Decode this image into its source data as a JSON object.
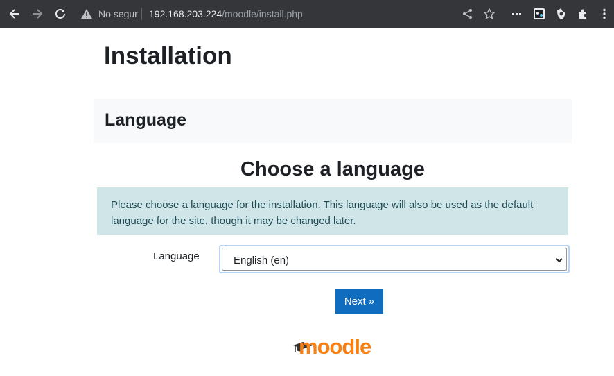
{
  "browser": {
    "security_label": "No segur",
    "url_host": "192.168.203.224",
    "url_path": "/moodle/install.php",
    "icons": [
      "back-arrow-icon",
      "forward-arrow-icon",
      "reload-icon",
      "warning-icon",
      "share-icon",
      "star-icon",
      "extension-dots-icon",
      "extension-badge-icon",
      "extension-shield-icon",
      "puzzle-icon",
      "kebab-menu-icon"
    ]
  },
  "page": {
    "title": "Installation",
    "section_title": "Language",
    "heading": "Choose a language",
    "alert": "Please choose a language for the installation. This language will also be used as the default language for the site, though it may be changed later.",
    "language_label": "Language",
    "language_selected": "English (en)",
    "next_label": "Next »",
    "logo_text": "moodle"
  },
  "colors": {
    "toolbar": "#35363a",
    "primary_button": "#0f6cbf",
    "alert_bg": "#cfe5e8",
    "logo_orange": "#f98012"
  }
}
